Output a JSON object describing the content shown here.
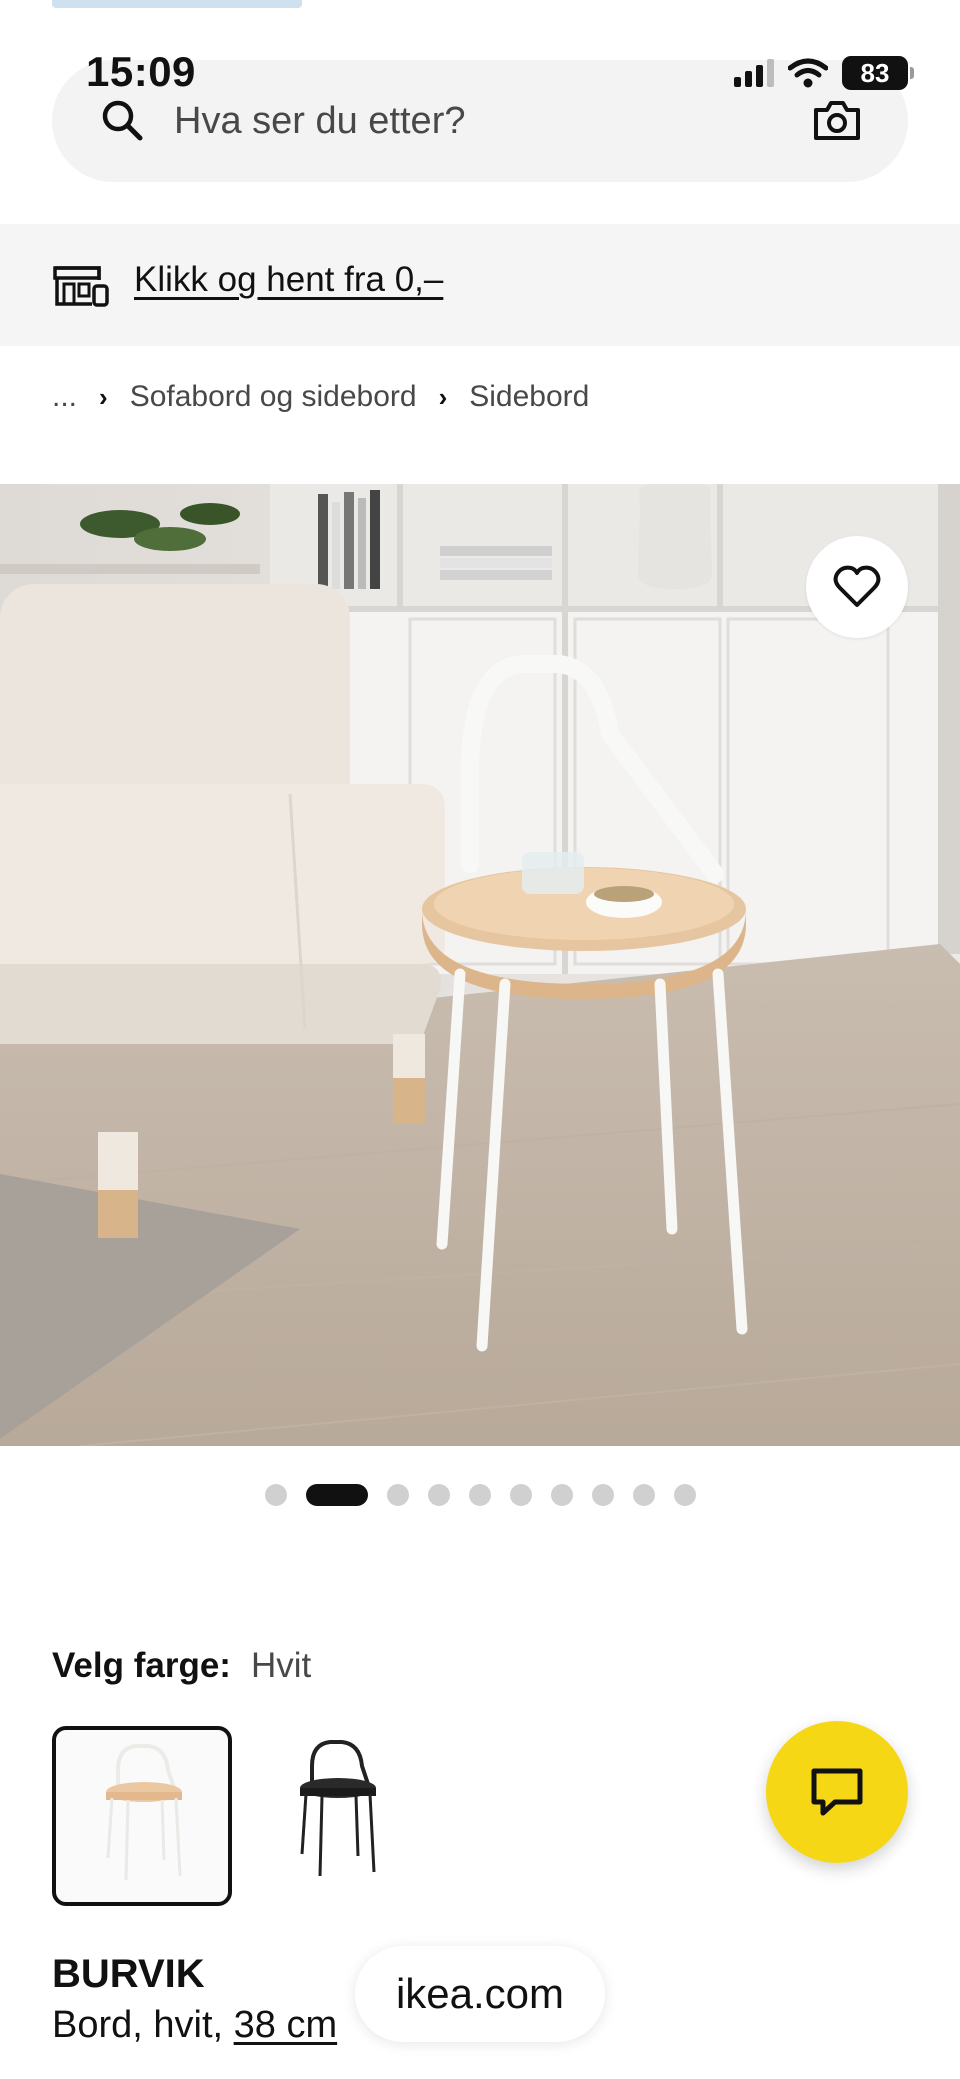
{
  "status_bar": {
    "time": "15:09",
    "battery": "83",
    "icons": [
      "cellular-signal-icon",
      "wifi-icon",
      "battery-icon"
    ]
  },
  "search": {
    "placeholder": "Hva ser du etter?",
    "left_icon": "search-icon",
    "right_icon": "camera-icon"
  },
  "promo": {
    "icon": "store-pickup-icon",
    "link_text": "Klikk og hent fra 0,–"
  },
  "breadcrumb": {
    "items": [
      "...",
      "Sofabord og sidebord",
      "Sidebord"
    ],
    "separator_icon": "chevron-right-icon"
  },
  "gallery": {
    "favorite_icon": "heart-outline-icon",
    "total_images": 10,
    "active_index": 1
  },
  "color_picker": {
    "label": "Velg farge:",
    "selected_value": "Hvit",
    "options": [
      "white-birch-table-swatch",
      "black-table-swatch"
    ]
  },
  "chat": {
    "icon": "chat-bubble-icon",
    "color": "#f5d716"
  },
  "product": {
    "name": "BURVIK",
    "description_prefix": "Bord, hvit, ",
    "size_link": "38 cm"
  },
  "browser": {
    "domain": "ikea.com"
  }
}
